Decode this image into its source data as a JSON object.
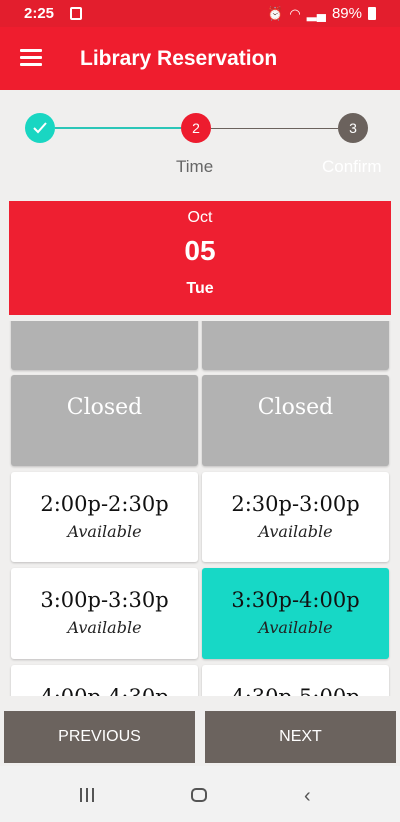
{
  "status_bar": {
    "time": "2:25",
    "battery": "89%"
  },
  "app_bar": {
    "title": "Library Reservation"
  },
  "stepper": {
    "steps": [
      {
        "number": "1",
        "label": "",
        "state": "done"
      },
      {
        "number": "2",
        "label": "Time",
        "state": "active"
      },
      {
        "number": "3",
        "label": "Confirm",
        "state": "pending"
      }
    ]
  },
  "date_header": {
    "month": "Oct",
    "day": "05",
    "weekday": "Tue"
  },
  "slots": [
    {
      "time": "",
      "status": ""
    },
    {
      "time": "",
      "status": ""
    },
    {
      "time": "Closed",
      "status": ""
    },
    {
      "time": "Closed",
      "status": ""
    },
    {
      "time": "2:00p-2:30p",
      "status": "Available"
    },
    {
      "time": "2:30p-3:00p",
      "status": "Available"
    },
    {
      "time": "3:00p-3:30p",
      "status": "Available"
    },
    {
      "time": "3:30p-4:00p",
      "status": "Available"
    },
    {
      "time": "4:00p-4:30p",
      "status": ""
    },
    {
      "time": "4:30p-5:00p",
      "status": ""
    }
  ],
  "buttons": {
    "previous": "PREVIOUS",
    "next": "NEXT"
  },
  "colors": {
    "primary": "#ef1d2e",
    "accent": "#17d8c6",
    "closed": "#b2b2b2",
    "button": "#6b635e"
  }
}
